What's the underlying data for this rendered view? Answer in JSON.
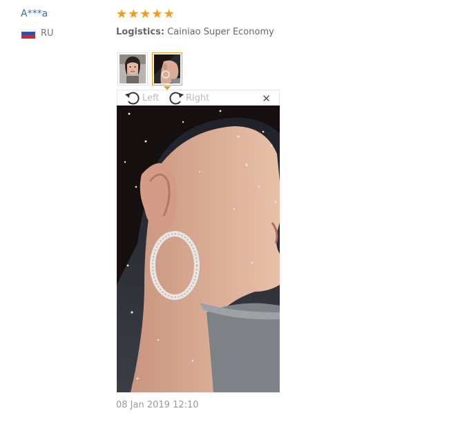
{
  "reviewer": {
    "name": "A***a",
    "country_code": "RU",
    "flag_icon": "russia-flag-icon"
  },
  "rating": {
    "stars": 5,
    "max": 5,
    "color": "#f49b1b"
  },
  "logistics": {
    "label": "Logistics:",
    "value": "Cainiao Super Economy"
  },
  "photos": {
    "thumbnails": [
      "photo-1",
      "photo-2"
    ],
    "selected_index": 1
  },
  "viewer": {
    "rotate_left_label": "Left",
    "rotate_right_label": "Right",
    "close_icon": "close-icon"
  },
  "review_date": "08 Jan 2019 12:10"
}
